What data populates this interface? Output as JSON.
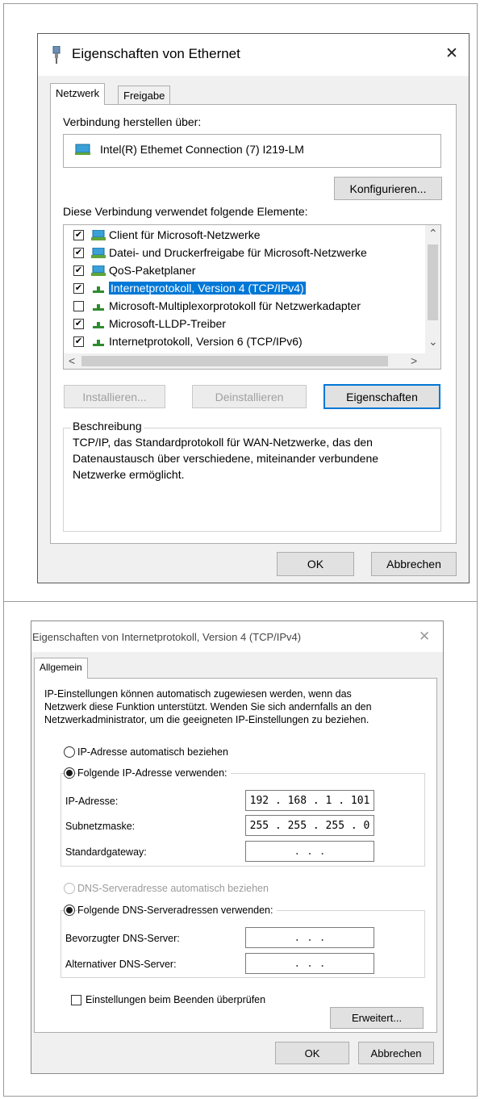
{
  "dialog1": {
    "title": "Eigenschaften von Ethernet",
    "close_glyph": "✕",
    "tabs": [
      "Netzwerk",
      "Freigabe"
    ],
    "connect_via_label": "Verbindung herstellen über:",
    "adapter_name": "Intel(R) Ethemet Connection (7) I219-LM",
    "configure_button": "Konfigurieren...",
    "elements_label": "Diese Verbindung verwendet folgende Elemente:",
    "items": [
      {
        "label": "Client für Microsoft-Netzwerke",
        "checked": true,
        "icon": "network-client-icon"
      },
      {
        "label": "Datei- und Druckerfreigabe für Microsoft-Netzwerke",
        "checked": true,
        "icon": "network-service-icon"
      },
      {
        "label": "QoS-Paketplaner",
        "checked": true,
        "icon": "network-service-icon"
      },
      {
        "label": "Internetprotokoll, Version 4 (TCP/IPv4)",
        "checked": true,
        "icon": "protocol-icon",
        "selected": true
      },
      {
        "label": "Microsoft-Multiplexorprotokoll für Netzwerkadapter",
        "checked": false,
        "icon": "protocol-icon"
      },
      {
        "label": "Microsoft-LLDP-Treiber",
        "checked": true,
        "icon": "protocol-icon"
      },
      {
        "label": "Internetprotokoll, Version 6 (TCP/IPv6)",
        "checked": true,
        "icon": "protocol-icon"
      }
    ],
    "check_glyph": "✔",
    "scroll_up": "⌃",
    "scroll_down": "⌄",
    "scroll_left": "<",
    "scroll_right": ">",
    "install_button": "Installieren...",
    "uninstall_button": "Deinstallieren",
    "properties_button": "Eigenschaften",
    "description_label": "Beschreibung",
    "description_lines": [
      "TCP/IP, das Standardprotokoll für WAN-Netzwerke, das den",
      "Datenaustausch über verschiedene, miteinander verbundene",
      "Netzwerke ermöglicht."
    ],
    "ok_button": "OK",
    "cancel_button": "Abbrechen"
  },
  "dialog2": {
    "title": "Eigenschaften von Internetprotokoll, Version 4 (TCP/IPv4)",
    "close_glyph": "✕",
    "tab": "Allgemein",
    "intro_lines": [
      "IP-Einstellungen können automatisch zugewiesen werden, wenn das",
      "Netzwerk diese Funktion unterstützt. Wenden Sie sich andernfalls an den",
      "Netzwerkadministrator, um die geeigneten IP-Einstellungen zu beziehen."
    ],
    "radio_ip_auto": "IP-Adresse automatisch beziehen",
    "radio_ip_manual": "Folgende IP-Adresse verwenden:",
    "ip_label": "IP-Adresse:",
    "ip_value": "192 . 168 . 1 . 101",
    "subnet_label": "Subnetzmaske:",
    "subnet_value": "255 . 255 . 255 . 0",
    "gateway_label": "Standardgateway:",
    "gateway_value": ". . .",
    "radio_dns_auto": "DNS-Serveradresse automatisch beziehen",
    "radio_dns_manual": "Folgende DNS-Serveradressen verwenden:",
    "dns_pref_label": "Bevorzugter DNS-Server:",
    "dns_pref_value": ". . .",
    "dns_alt_label": "Alternativer DNS-Server:",
    "dns_alt_value": ". . .",
    "validate_checkbox": "Einstellungen beim Beenden überprüfen",
    "advanced_button": "Erweitert...",
    "ok_button": "OK",
    "cancel_button": "Abbrechen"
  }
}
